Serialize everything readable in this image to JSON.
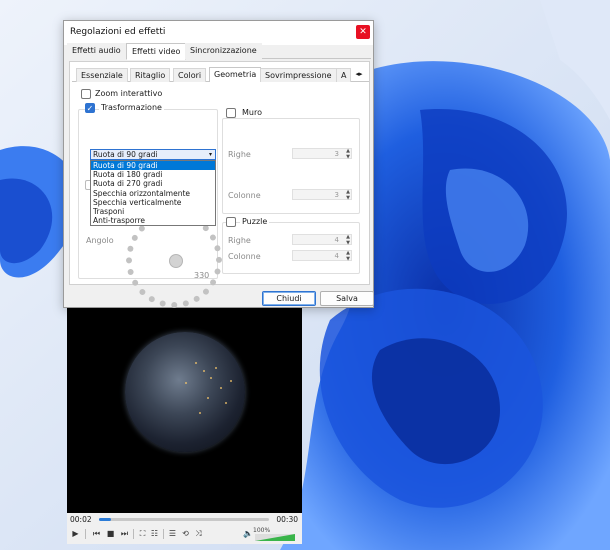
{
  "dialog": {
    "title": "Regolazioni ed effetti",
    "close_glyph": "✕",
    "tabs": [
      "Effetti audio",
      "Effetti video",
      "Sincronizzazione"
    ],
    "active_tab": "Effetti video",
    "subtabs": [
      "Essenziale",
      "Ritaglio",
      "Colori",
      "Geometria",
      "Sovrimpressione",
      "A"
    ],
    "active_subtab": "Geometria",
    "subtab_scroll_glyph": "◂▸",
    "zoom_label": "Zoom interattivo",
    "transform_label": "Trasformazione",
    "transform_selected": "Ruota di 90 gradi",
    "transform_options": [
      "Ruota di 90 gradi",
      "Ruota di 180 gradi",
      "Ruota di 270 gradi",
      "Specchia orizzontalmente",
      "Specchia verticalmente",
      "Trasponi",
      "Anti-trasporre"
    ],
    "angle_label": "Angolo",
    "angle_value": "330",
    "wall": {
      "label": "Muro",
      "rows_label": "Righe",
      "rows_value": "3",
      "cols_label": "Colonne",
      "cols_value": "3"
    },
    "puzzle": {
      "label": "Puzzle",
      "rows_label": "Righe",
      "rows_value": "4",
      "cols_label": "Colonne",
      "cols_value": "4"
    },
    "close_button": "Chiudi",
    "save_button": "Salva"
  },
  "player": {
    "time_elapsed": "00:02",
    "time_total": "00:30",
    "progress_fraction": 0.07,
    "volume_label": "100%",
    "volume_fraction": 1.0
  },
  "colors": {
    "accent": "#2e73d1",
    "close": "#e81123",
    "volume": "#39b54a",
    "wallpaper_blue": "#1f5fe0"
  }
}
